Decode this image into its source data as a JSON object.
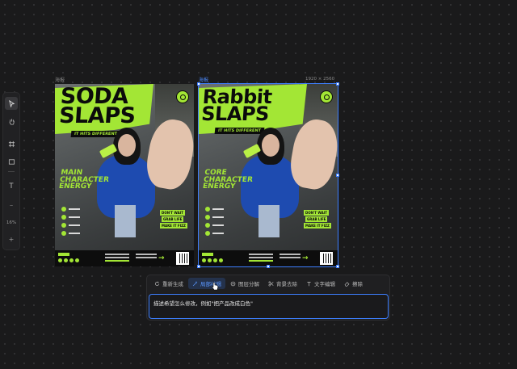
{
  "toolbar": {
    "tools": [
      {
        "icon": "pointer-icon",
        "active": true
      },
      {
        "icon": "hand-icon",
        "active": false
      },
      {
        "icon": "frame-grid-icon",
        "active": false
      },
      {
        "icon": "rectangle-icon",
        "active": false
      },
      {
        "icon": "text-icon",
        "label": "T",
        "active": false
      }
    ],
    "zoom_out": "−",
    "zoom_level": "16%",
    "zoom_in": "+"
  },
  "artboards": [
    {
      "label": "海报",
      "title_lines": [
        "SODA",
        "SLAPS"
      ],
      "slogan": "IT HITS DIFFERENT",
      "side_title": [
        "MAIN",
        "CHARACTER",
        "ENERGY"
      ],
      "tags": [
        "DON'T WAIT",
        "GRAB LIFE",
        "MAKE IT FIZZ"
      ]
    },
    {
      "label": "海报",
      "size": "1920 × 2560",
      "title_lines": [
        "Rabbit",
        "SLAPS"
      ],
      "slogan": "IT HITS DIFFERENT",
      "side_title": [
        "CORE",
        "CHARACTER",
        "ENERGY"
      ],
      "tags": [
        "DON'T WAIT",
        "GRAB LIFE",
        "MAKE IT FIZZ"
      ]
    }
  ],
  "actions": [
    {
      "label": "重新生成",
      "icon": "refresh-icon",
      "active": false
    },
    {
      "label": "局部编辑",
      "icon": "magic-wand-icon",
      "active": true
    },
    {
      "label": "图层分解",
      "icon": "layers-icon",
      "active": false
    },
    {
      "label": "背景去除",
      "icon": "scissors-icon",
      "active": false
    },
    {
      "label": "文字编辑",
      "icon": "text-edit-icon",
      "active": false
    },
    {
      "label": "擦除",
      "icon": "eraser-icon",
      "active": false
    }
  ],
  "prompt": {
    "value": "描述希望怎么修改，例如\"把产品改成白色\""
  },
  "colors": {
    "accent": "#3d7fff",
    "brand_green": "#a3e635",
    "canvas_bg": "#1a1a1b"
  }
}
